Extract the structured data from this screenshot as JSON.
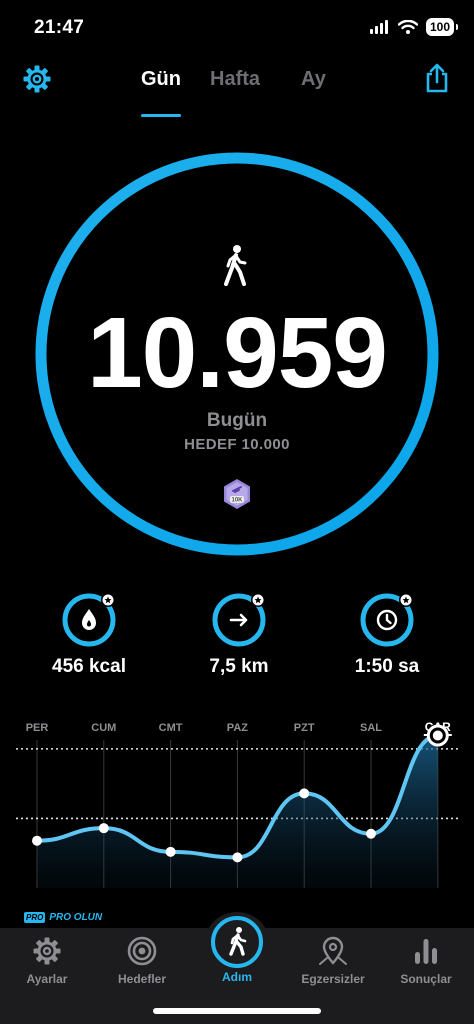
{
  "status_bar": {
    "time": "21:47",
    "battery": "100",
    "icons": [
      "signal-icon",
      "wifi-icon",
      "battery-icon"
    ]
  },
  "header": {
    "tabs": [
      {
        "label": "Gün",
        "active": true
      },
      {
        "label": "Hafta",
        "active": false
      },
      {
        "label": "Ay",
        "active": false
      }
    ],
    "icons": [
      "gear-icon",
      "share-icon"
    ]
  },
  "summary": {
    "steps": "10.959",
    "period_label": "Bugün",
    "goal_label": "HEDEF 10.000",
    "badge_text": "10K",
    "progress": 1.0
  },
  "stats": [
    {
      "icon": "flame-icon",
      "value": "456 kcal",
      "progress": 1.0
    },
    {
      "icon": "arrow-right-icon",
      "value": "7,5 km",
      "progress": 1.0
    },
    {
      "icon": "clock-icon",
      "value": "1:50 sa",
      "progress": 1.0
    }
  ],
  "chart_data": {
    "type": "area",
    "categories": [
      "PER",
      "CUM",
      "CMT",
      "PAZ",
      "PZT",
      "SAL",
      "ÇAR"
    ],
    "values": [
      3400,
      4300,
      2600,
      2200,
      6800,
      3900,
      10959
    ],
    "highlight_index": 6,
    "reference_lines": [
      10000,
      5000
    ],
    "ylim": [
      0,
      11500
    ],
    "grid": true
  },
  "promo": {
    "tag": "PRO",
    "label": "PRO OLUN"
  },
  "nav": [
    {
      "label": "Ayarlar",
      "icon": "gear-icon",
      "active": false
    },
    {
      "label": "Hedefler",
      "icon": "target-icon",
      "active": false
    },
    {
      "label": "Adım",
      "icon": "walker-icon",
      "active": true
    },
    {
      "label": "Egzersizler",
      "icon": "map-pin-icon",
      "active": false
    },
    {
      "label": "Sonuçlar",
      "icon": "bar-chart-icon",
      "active": false
    }
  ],
  "colors": {
    "accent": "#27b7ef",
    "accent_dark": "#0a6fae",
    "muted": "#8e8e93",
    "nav_bg": "#1c1c1e"
  }
}
